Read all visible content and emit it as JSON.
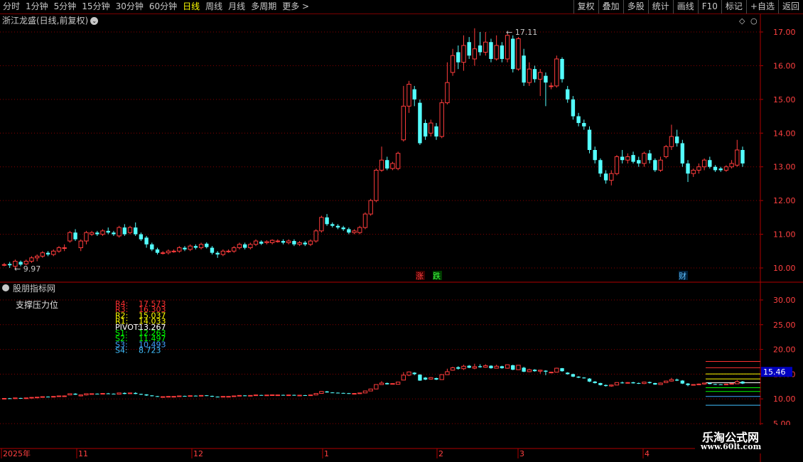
{
  "toolbar": {
    "left": [
      "分时",
      "1分钟",
      "5分钟",
      "15分钟",
      "30分钟",
      "60分钟",
      "日线",
      "周线",
      "月线",
      "多周期",
      "更多 >"
    ],
    "active": "日线",
    "right": [
      "复权",
      "叠加",
      "多股",
      "统计",
      "画线",
      "F10",
      "标记",
      "+自选",
      "返回"
    ]
  },
  "main_title": "浙江龙盛(日线,前复权)",
  "indicator_title": "股朋指标网",
  "indicator_label": "支撑压力位",
  "pivot_levels": [
    {
      "name": "R4:",
      "value": "17.573",
      "color": "#ff3030"
    },
    {
      "name": "R3:",
      "value": "16.303",
      "color": "#ff3030"
    },
    {
      "name": "R2:",
      "value": "15.037",
      "color": "#ffff00"
    },
    {
      "name": "R1:",
      "value": "14.033",
      "color": "#ffff00"
    },
    {
      "name": "PIVOT:",
      "value": "13.267",
      "color": "#ffffff"
    },
    {
      "name": "S1:",
      "value": "12.263",
      "color": "#00ff00"
    },
    {
      "name": "S2:",
      "value": "11.497",
      "color": "#00ff00"
    },
    {
      "name": "S3:",
      "value": "10.493",
      "color": "#40a0ff"
    },
    {
      "name": "S4:",
      "value": "8.723",
      "color": "#40c0ff"
    }
  ],
  "price_axis": [
    "17.00",
    "16.00",
    "15.00",
    "14.00",
    "13.00",
    "12.00",
    "11.00",
    "10.00"
  ],
  "ind_axis": [
    "30.00",
    "25.00",
    "20.00",
    "15.00",
    "10.00",
    "5.00"
  ],
  "ind_current_label": "15.46",
  "max_label": "17.11",
  "min_label": "9.97",
  "markers": [
    {
      "text": "涨",
      "color": "#ff4040",
      "bg": "#3a0000"
    },
    {
      "text": "跌",
      "color": "#40ff40",
      "bg": "#003a00"
    },
    {
      "text": "财",
      "color": "#60c0ff",
      "bg": "#00203a"
    }
  ],
  "date_axis": [
    "2025年",
    "11",
    "12",
    "1",
    "2",
    "3",
    "4"
  ],
  "logo": {
    "main": "乐淘公式网",
    "sub": "www.60lt.com"
  },
  "chart_data": {
    "type": "candlestick",
    "ylim": [
      9.7,
      17.3
    ],
    "candles": [
      [
        10.1,
        10.1,
        10.15,
        10.05
      ],
      [
        10.12,
        10.08,
        10.18,
        10.0
      ],
      [
        10.05,
        10.2,
        10.25,
        9.97
      ],
      [
        10.18,
        10.1,
        10.22,
        10.05
      ],
      [
        10.12,
        10.2,
        10.25,
        10.08
      ],
      [
        10.2,
        10.3,
        10.35,
        10.15
      ],
      [
        10.3,
        10.35,
        10.4,
        10.2
      ],
      [
        10.35,
        10.45,
        10.5,
        10.3
      ],
      [
        10.45,
        10.4,
        10.5,
        10.35
      ],
      [
        10.4,
        10.5,
        10.55,
        10.35
      ],
      [
        10.5,
        10.6,
        10.65,
        10.45
      ],
      [
        10.6,
        10.6,
        10.7,
        10.5
      ],
      [
        10.8,
        11.05,
        11.1,
        10.75
      ],
      [
        11.05,
        10.85,
        11.15,
        10.8
      ],
      [
        10.6,
        10.8,
        10.85,
        10.5
      ],
      [
        10.8,
        11.05,
        11.1,
        10.7
      ],
      [
        11.0,
        11.05,
        11.1,
        10.95
      ],
      [
        11.05,
        11.0,
        11.1,
        10.95
      ],
      [
        11.0,
        11.1,
        11.15,
        10.95
      ],
      [
        11.1,
        11.05,
        11.2,
        11.0
      ],
      [
        11.05,
        11.0,
        11.1,
        10.95
      ],
      [
        10.95,
        11.2,
        11.25,
        10.9
      ],
      [
        11.2,
        11.0,
        11.3,
        10.95
      ],
      [
        11.05,
        11.2,
        11.25,
        11.0
      ],
      [
        11.2,
        11.0,
        11.35,
        10.95
      ],
      [
        11.0,
        10.85,
        11.05,
        10.8
      ],
      [
        10.9,
        10.7,
        10.95,
        10.6
      ],
      [
        10.7,
        10.55,
        10.75,
        10.5
      ],
      [
        10.55,
        10.45,
        10.6,
        10.4
      ],
      [
        10.45,
        10.45,
        10.5,
        10.4
      ],
      [
        10.45,
        10.5,
        10.55,
        10.4
      ],
      [
        10.5,
        10.5,
        10.55,
        10.45
      ],
      [
        10.5,
        10.6,
        10.65,
        10.45
      ],
      [
        10.6,
        10.55,
        10.65,
        10.5
      ],
      [
        10.55,
        10.65,
        10.7,
        10.5
      ],
      [
        10.65,
        10.6,
        10.7,
        10.55
      ],
      [
        10.6,
        10.7,
        10.75,
        10.55
      ],
      [
        10.72,
        10.62,
        10.76,
        10.58
      ],
      [
        10.6,
        10.45,
        10.65,
        10.4
      ],
      [
        10.45,
        10.4,
        10.5,
        10.3
      ],
      [
        10.4,
        10.5,
        10.55,
        10.35
      ],
      [
        10.5,
        10.5,
        10.55,
        10.45
      ],
      [
        10.5,
        10.6,
        10.65,
        10.45
      ],
      [
        10.6,
        10.7,
        10.75,
        10.55
      ],
      [
        10.7,
        10.6,
        10.75,
        10.55
      ],
      [
        10.6,
        10.7,
        10.75,
        10.55
      ],
      [
        10.7,
        10.8,
        10.85,
        10.65
      ],
      [
        10.78,
        10.72,
        10.82,
        10.68
      ],
      [
        10.75,
        10.78,
        10.82,
        10.7
      ],
      [
        10.75,
        10.82,
        10.85,
        10.7
      ],
      [
        10.8,
        10.8,
        10.85,
        10.75
      ],
      [
        10.8,
        10.75,
        10.85,
        10.7
      ],
      [
        10.75,
        10.8,
        10.85,
        10.7
      ],
      [
        10.8,
        10.7,
        10.85,
        10.65
      ],
      [
        10.7,
        10.75,
        10.8,
        10.65
      ],
      [
        10.75,
        10.7,
        10.8,
        10.65
      ],
      [
        10.7,
        10.8,
        10.85,
        10.65
      ],
      [
        10.8,
        11.1,
        11.15,
        10.75
      ],
      [
        11.1,
        11.5,
        11.55,
        11.05
      ],
      [
        11.5,
        11.3,
        11.6,
        11.25
      ],
      [
        11.3,
        11.25,
        11.35,
        11.2
      ],
      [
        11.25,
        11.2,
        11.3,
        11.15
      ],
      [
        11.2,
        11.15,
        11.25,
        11.1
      ],
      [
        11.15,
        11.05,
        11.2,
        11.0
      ],
      [
        11.05,
        11.1,
        11.15,
        11.0
      ],
      [
        11.05,
        11.2,
        11.25,
        11.0
      ],
      [
        11.2,
        11.6,
        11.65,
        11.15
      ],
      [
        11.6,
        12.0,
        12.05,
        11.55
      ],
      [
        12.0,
        12.9,
        12.95,
        11.95
      ],
      [
        12.9,
        13.2,
        13.6,
        12.85
      ],
      [
        13.2,
        12.95,
        13.3,
        12.9
      ],
      [
        12.95,
        13.1,
        13.15,
        12.9
      ],
      [
        12.95,
        13.4,
        13.45,
        12.9
      ],
      [
        13.8,
        14.8,
        15.4,
        13.75
      ],
      [
        14.8,
        15.45,
        15.55,
        14.6
      ],
      [
        15.3,
        15.0,
        15.4,
        14.8
      ],
      [
        14.9,
        13.7,
        15.0,
        13.65
      ],
      [
        14.3,
        13.9,
        14.4,
        13.8
      ],
      [
        14.0,
        14.3,
        14.4,
        13.9
      ],
      [
        14.2,
        13.9,
        14.3,
        13.8
      ],
      [
        13.9,
        14.9,
        15.0,
        13.85
      ],
      [
        14.9,
        15.5,
        16.1,
        14.85
      ],
      [
        15.8,
        16.3,
        16.5,
        15.7
      ],
      [
        16.4,
        16.1,
        16.6,
        15.9
      ],
      [
        16.1,
        16.6,
        16.9,
        15.85
      ],
      [
        16.7,
        16.3,
        16.85,
        16.2
      ],
      [
        16.2,
        16.5,
        17.11,
        16.0
      ],
      [
        16.6,
        16.4,
        17.0,
        16.3
      ],
      [
        16.4,
        16.7,
        17.0,
        16.3
      ],
      [
        16.7,
        16.2,
        16.8,
        16.1
      ],
      [
        16.2,
        16.6,
        16.9,
        16.15
      ],
      [
        16.6,
        16.2,
        16.7,
        16.1
      ],
      [
        16.2,
        16.9,
        16.95,
        16.1
      ],
      [
        16.8,
        15.9,
        16.9,
        15.8
      ],
      [
        15.9,
        16.8,
        16.85,
        15.85
      ],
      [
        16.3,
        15.5,
        16.5,
        15.4
      ],
      [
        15.5,
        15.9,
        16.1,
        15.4
      ],
      [
        15.9,
        15.6,
        16.0,
        15.5
      ],
      [
        15.6,
        15.8,
        15.9,
        15.1
      ],
      [
        15.7,
        15.5,
        15.8,
        14.8
      ],
      [
        15.4,
        15.4,
        15.5,
        15.3
      ],
      [
        15.4,
        16.2,
        16.3,
        15.35
      ],
      [
        16.2,
        15.6,
        16.25,
        15.5
      ],
      [
        15.3,
        15.0,
        15.4,
        14.9
      ],
      [
        15.0,
        14.5,
        15.1,
        14.4
      ],
      [
        14.5,
        14.3,
        14.6,
        14.2
      ],
      [
        14.3,
        14.2,
        14.4,
        14.1
      ],
      [
        14.1,
        13.5,
        14.2,
        13.4
      ],
      [
        13.5,
        13.2,
        13.6,
        13.1
      ],
      [
        13.2,
        12.8,
        13.25,
        12.7
      ],
      [
        12.8,
        12.6,
        12.9,
        12.5
      ],
      [
        12.6,
        12.8,
        12.9,
        12.45
      ],
      [
        12.8,
        13.3,
        13.35,
        12.75
      ],
      [
        13.3,
        13.2,
        13.5,
        13.1
      ],
      [
        13.2,
        13.3,
        13.4,
        13.1
      ],
      [
        13.35,
        13.15,
        13.45,
        13.1
      ],
      [
        13.2,
        13.1,
        13.3,
        13.0
      ],
      [
        13.1,
        13.4,
        13.45,
        13.0
      ],
      [
        13.4,
        13.2,
        13.5,
        13.1
      ],
      [
        13.2,
        12.9,
        13.25,
        12.85
      ],
      [
        12.9,
        13.2,
        13.3,
        12.85
      ],
      [
        13.3,
        13.6,
        13.65,
        13.25
      ],
      [
        13.6,
        13.9,
        14.25,
        13.5
      ],
      [
        13.9,
        13.7,
        14.1,
        13.6
      ],
      [
        13.7,
        13.1,
        13.8,
        13.0
      ],
      [
        13.1,
        12.8,
        13.2,
        12.55
      ],
      [
        12.8,
        12.9,
        12.95,
        12.7
      ],
      [
        12.9,
        13.0,
        13.1,
        12.8
      ],
      [
        13.0,
        13.2,
        13.25,
        12.9
      ],
      [
        13.2,
        13.0,
        13.3,
        12.95
      ],
      [
        13.0,
        12.9,
        13.05,
        12.85
      ],
      [
        12.95,
        12.9,
        13.0,
        12.85
      ],
      [
        12.9,
        13.0,
        13.05,
        12.85
      ],
      [
        13.0,
        13.1,
        13.2,
        12.95
      ],
      [
        13.05,
        13.5,
        13.8,
        13.0
      ],
      [
        13.5,
        13.1,
        13.6,
        13.0
      ]
    ]
  }
}
